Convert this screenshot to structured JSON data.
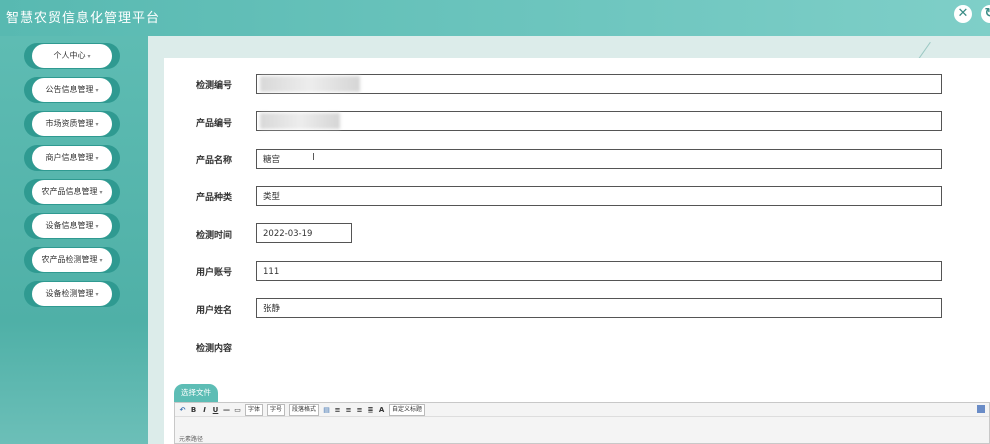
{
  "header": {
    "title": "智慧农贸信息化管理平台",
    "close_label": "✕",
    "refresh_label": "↻"
  },
  "sidebar": {
    "items": [
      {
        "label": "个人中心"
      },
      {
        "label": "公告信息管理"
      },
      {
        "label": "市场资质管理"
      },
      {
        "label": "商户信息管理"
      },
      {
        "label": "农产品信息管理"
      },
      {
        "label": "设备信息管理"
      },
      {
        "label": "农产品检测管理"
      },
      {
        "label": "设备检测管理"
      }
    ],
    "caret": "▾"
  },
  "form": {
    "fields": [
      {
        "label": "检测编号",
        "value": ""
      },
      {
        "label": "产品编号",
        "value": ""
      },
      {
        "label": "产品名称",
        "value": "糖宫"
      },
      {
        "label": "产品种类",
        "value": "类型"
      },
      {
        "label": "检测时间",
        "value": "2022-03-19"
      },
      {
        "label": "用户账号",
        "value": "111"
      },
      {
        "label": "用户姓名",
        "value": "张静"
      }
    ],
    "content_label": "检测内容"
  },
  "editor": {
    "upload_label": "选择文件",
    "toolbar": {
      "undo": "↶",
      "bold": "B",
      "italic": "I",
      "underline": "U",
      "font_select": "字体",
      "size_select": "字号",
      "format_select": "段落格式",
      "custom_select": "自定义标题",
      "font_color": "A"
    },
    "element_path": "元素路径"
  }
}
